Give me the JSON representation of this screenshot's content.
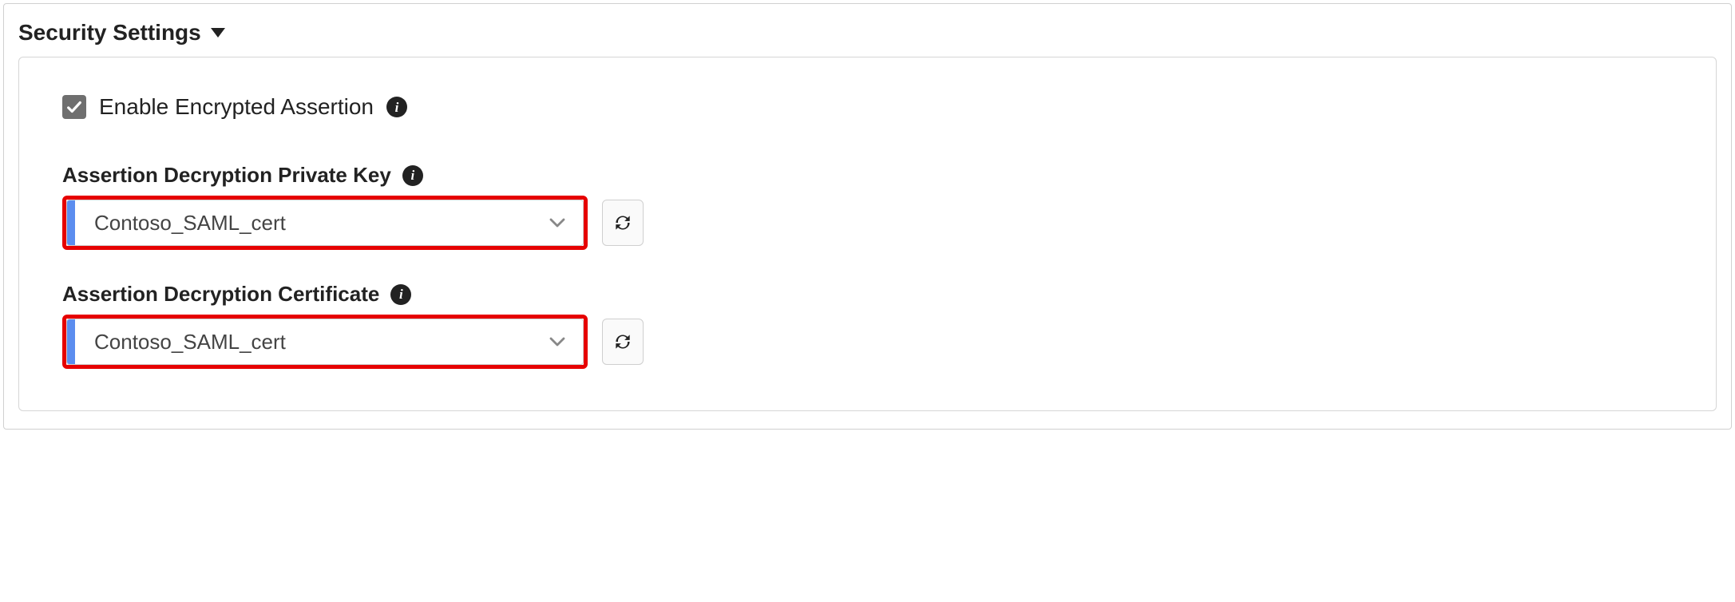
{
  "section": {
    "title": "Security Settings"
  },
  "enable_encrypted": {
    "label": "Enable Encrypted Assertion",
    "checked": true
  },
  "fields": {
    "private_key": {
      "label": "Assertion Decryption Private Key",
      "value": "Contoso_SAML_cert"
    },
    "certificate": {
      "label": "Assertion Decryption Certificate",
      "value": "Contoso_SAML_cert"
    }
  },
  "colors": {
    "highlight": "#e60000",
    "accent_tab": "#5b8def",
    "checkbox_bg": "#6f6f6f"
  }
}
